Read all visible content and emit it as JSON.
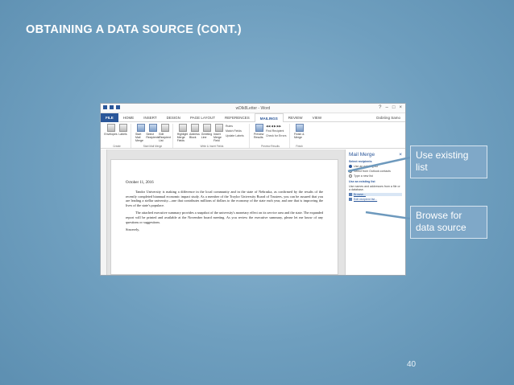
{
  "slide": {
    "title": "OBTAINING A DATA SOURCE (CONT.)",
    "page_number": "40"
  },
  "word": {
    "window_title": "wDlk8Letter - Word",
    "account": "Dobriing Samo",
    "tabs": [
      {
        "label": "FILE"
      },
      {
        "label": "HOME"
      },
      {
        "label": "INSERT"
      },
      {
        "label": "DESIGN"
      },
      {
        "label": "PAGE LAYOUT"
      },
      {
        "label": "REFERENCES"
      },
      {
        "label": "MAILINGS"
      },
      {
        "label": "REVIEW"
      },
      {
        "label": "VIEW"
      }
    ],
    "ribbon": {
      "create": {
        "label": "Create",
        "buttons": [
          "Envelopes",
          "Labels"
        ]
      },
      "start": {
        "label": "Start Mail Merge",
        "buttons": [
          "Start Mail Merge",
          "Select Recipients",
          "Edit Recipient List"
        ]
      },
      "write": {
        "label": "Write & Insert Fields",
        "buttons": [
          "Highlight Merge Fields",
          "Address Block",
          "Greeting Line",
          "Insert Merge Field"
        ],
        "small": [
          "Rules",
          "Match Fields",
          "Update Labels"
        ]
      },
      "preview": {
        "label": "Preview Results",
        "buttons": [
          "Preview Results"
        ],
        "small": [
          "Find Recipient",
          "Check for Errors"
        ]
      },
      "finish": {
        "label": "Finish",
        "buttons": [
          "Finish & Merge"
        ]
      }
    },
    "document": {
      "date": "October 11, 2016",
      "paragraphs": [
        "Tandor University is making a difference in the local community and in the state of Nebraska, as confirmed by the results of the recently completed biannual economic impact study. As a member of the Troylor University Board of Trustees, you can be assured that you are leading a stellar university—one that contributes millions of dollars to the economy of the state each year, and one that is improving the lives of the state's populace.",
        "The attached executive summary provides a snapshot of the university's monetary effect on its service area and the state. The expanded report will be printed and available at the November board meeting. As you review the executive summary, please let me know of any questions or suggestions."
      ],
      "closing": "Sincerely,"
    },
    "mail_merge_pane": {
      "title": "Mail Merge",
      "section1": "Select recipients",
      "options": [
        "Use an existing list",
        "Select from Outlook contacts",
        "Type a new list"
      ],
      "section2": "Use an existing list",
      "desc": "Use names and addresses from a file or a database.",
      "links": [
        "Browse...",
        "Edit recipient list..."
      ]
    }
  },
  "callouts": {
    "existing": "Use existing list",
    "browse": "Browse for data source"
  }
}
